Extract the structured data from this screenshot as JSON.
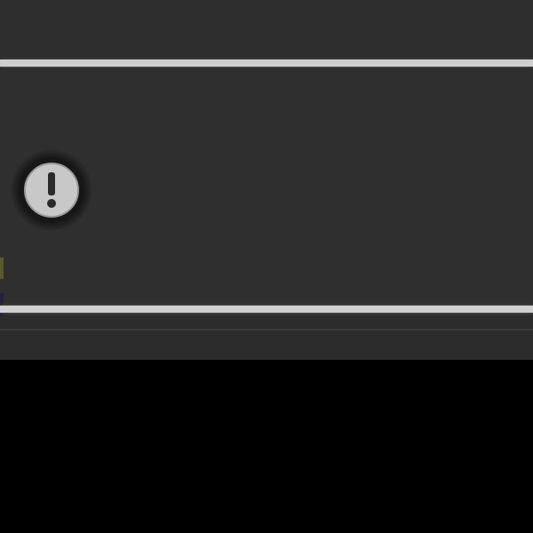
{
  "window": {
    "background_color": "#2e2e2e",
    "divider_color": "#cfcfcf",
    "lower_area_color": "#000000"
  },
  "row": {
    "status_icon": "exclamation-circle-icon",
    "icon_color": "#c8c8c8"
  }
}
